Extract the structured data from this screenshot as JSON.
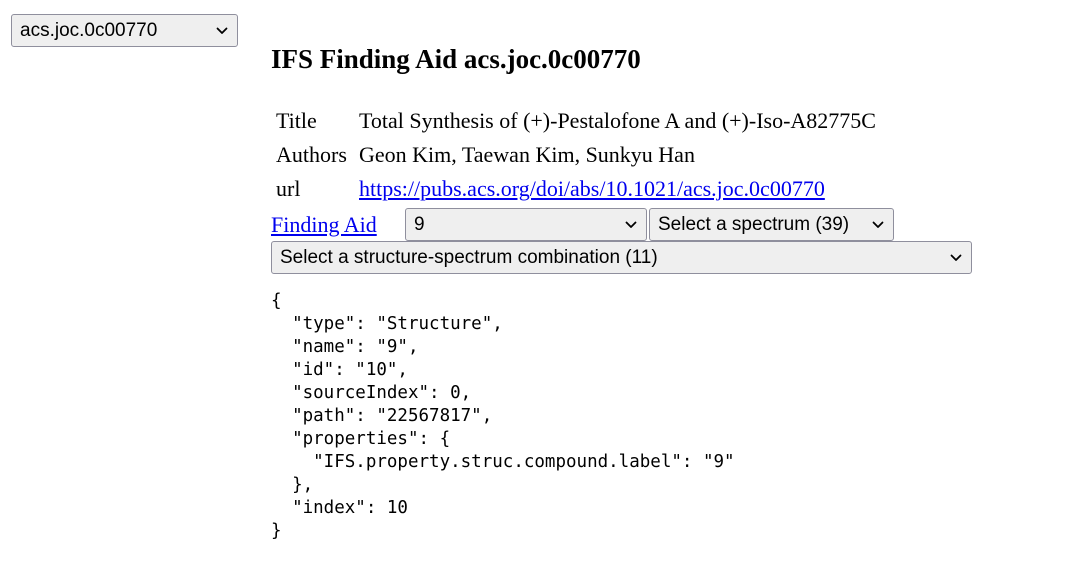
{
  "ifs_select": {
    "selected": "acs.joc.0c00770"
  },
  "heading": "IFS Finding Aid acs.joc.0c00770",
  "metadata": {
    "title_label": "Title",
    "title_value": "Total Synthesis of (+)-Pestalofone A and (+)-Iso-A82775C",
    "authors_label": "Authors",
    "authors_value": "Geon Kim, Taewan Kim, Sunkyu Han",
    "url_label": "url",
    "url_value": "https://pubs.acs.org/doi/abs/10.1021/acs.joc.0c00770"
  },
  "finding_aid_link": "Finding Aid",
  "compound_select": {
    "selected": "9"
  },
  "spectrum_select": {
    "selected": "Select a spectrum (39)"
  },
  "combo_select": {
    "selected": "Select a structure-spectrum combination (11)"
  },
  "json_view": "{\n  \"type\": \"Structure\",\n  \"name\": \"9\",\n  \"id\": \"10\",\n  \"sourceIndex\": 0,\n  \"path\": \"22567817\",\n  \"properties\": {\n    \"IFS.property.struc.compound.label\": \"9\"\n  },\n  \"index\": 10\n}",
  "icons": {
    "dropdown": "chevron-down-icon"
  }
}
